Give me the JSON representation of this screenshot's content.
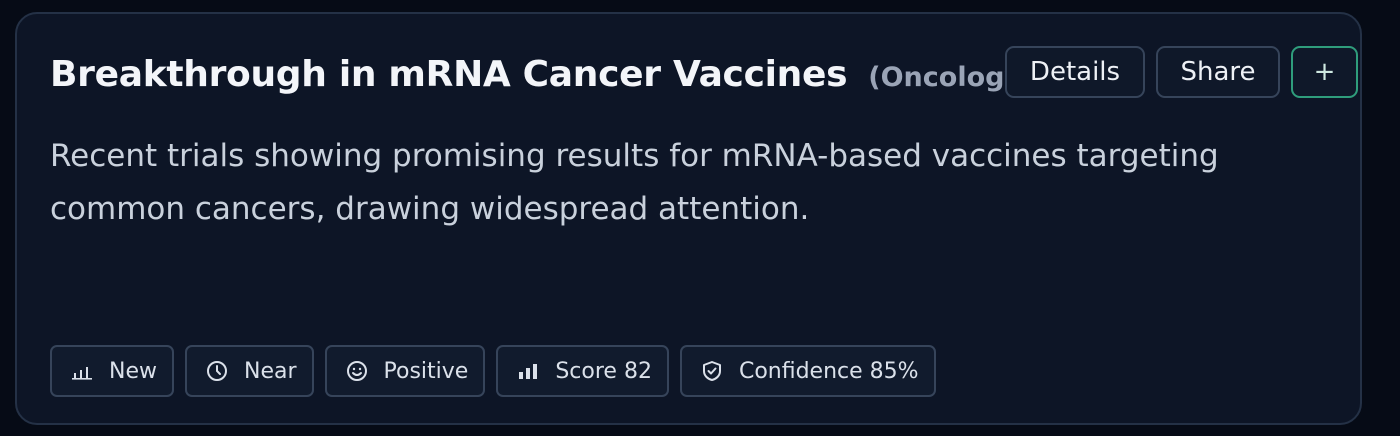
{
  "card": {
    "title": "Breakthrough in mRNA Cancer Vaccines",
    "category": "(Oncology)",
    "description": "Recent trials showing promising results for mRNA-based vaccines targeting common cancers, drawing widespread attention.",
    "actions": {
      "details_label": "Details",
      "share_label": "Share",
      "add_label": "+"
    },
    "tags": [
      {
        "icon": "bar-chart-icon",
        "label": "New"
      },
      {
        "icon": "clock-icon",
        "label": "Near"
      },
      {
        "icon": "smiley-icon",
        "label": "Positive"
      },
      {
        "icon": "bar-chart-icon",
        "label": "Score 82"
      },
      {
        "icon": "shield-check-icon",
        "label": "Confidence 85%"
      }
    ]
  },
  "colors": {
    "background": "#060b16",
    "card": "#0d1526",
    "border": "#243146",
    "accent": "#2f9d7c"
  }
}
